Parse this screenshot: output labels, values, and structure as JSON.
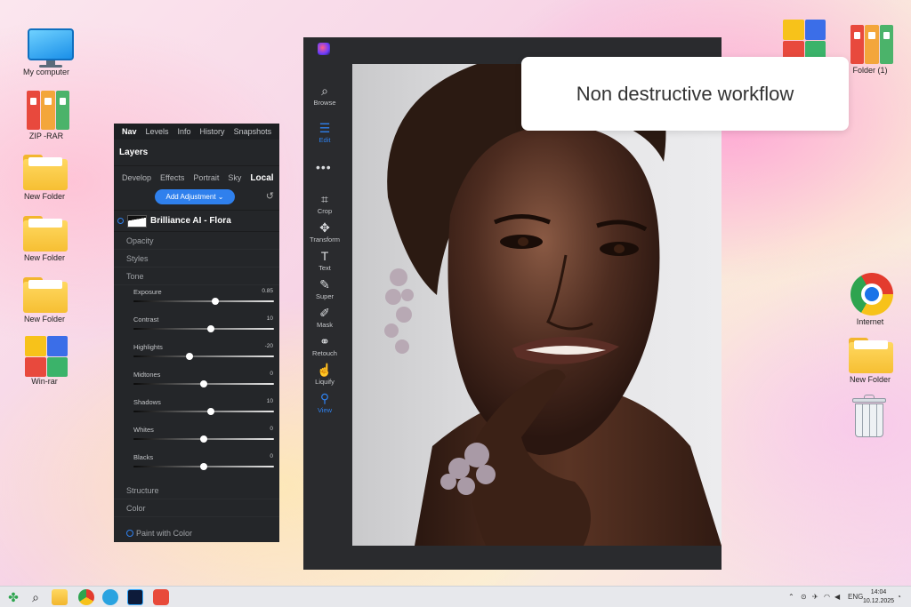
{
  "desktop": {
    "icons_left": [
      {
        "label": "My computer"
      },
      {
        "label": "ZIP -RAR"
      },
      {
        "label": "New Folder"
      },
      {
        "label": "New Folder"
      },
      {
        "label": "New Folder"
      },
      {
        "label": "Win-rar"
      }
    ],
    "icons_right": [
      {
        "label": ""
      },
      {
        "label": "Folder (1)"
      },
      {
        "label": "Internet"
      },
      {
        "label": "New Folder"
      },
      {
        "label": ""
      }
    ]
  },
  "panel": {
    "nav_tabs": [
      "Nav",
      "Levels",
      "Info",
      "History",
      "Snapshots"
    ],
    "title": "Layers",
    "tool_tabs": [
      "Develop",
      "Effects",
      "Portrait",
      "Sky",
      "Local"
    ],
    "add_adjustment": "Add Adjustment",
    "layer_name": "Brilliance AI - Flora",
    "sections_top": [
      "Opacity",
      "Styles",
      "Tone"
    ],
    "sliders": [
      {
        "name": "Exposure",
        "value": "0.85",
        "pos": 0.58
      },
      {
        "name": "Contrast",
        "value": "10",
        "pos": 0.55
      },
      {
        "name": "Highlights",
        "value": "-20",
        "pos": 0.4
      },
      {
        "name": "Midtones",
        "value": "0",
        "pos": 0.5
      },
      {
        "name": "Shadows",
        "value": "10",
        "pos": 0.55
      },
      {
        "name": "Whites",
        "value": "0",
        "pos": 0.5
      },
      {
        "name": "Blacks",
        "value": "0",
        "pos": 0.5
      }
    ],
    "sections_bottom": [
      "Structure",
      "Color"
    ],
    "paint_with_color": "Paint with Color"
  },
  "editor": {
    "tools": [
      {
        "icon": "browse-icon",
        "glyph": "⌕",
        "label": "Browse",
        "active": false
      },
      {
        "icon": "edit-icon",
        "glyph": "☰",
        "label": "Edit",
        "active": true
      },
      {
        "icon": "crop-icon",
        "glyph": "⌗",
        "label": "Crop",
        "active": false
      },
      {
        "icon": "transform-icon",
        "glyph": "✥",
        "label": "Transform",
        "active": false
      },
      {
        "icon": "text-icon",
        "glyph": "T",
        "label": "Text",
        "active": false
      },
      {
        "icon": "super-icon",
        "glyph": "✎",
        "label": "Super",
        "active": false
      },
      {
        "icon": "mask-icon",
        "glyph": "✐",
        "label": "Mask",
        "active": false
      },
      {
        "icon": "retouch-icon",
        "glyph": "⚭",
        "label": "Retouch",
        "active": false
      },
      {
        "icon": "liquify-icon",
        "glyph": "☝",
        "label": "Liquify",
        "active": false
      },
      {
        "icon": "view-icon",
        "glyph": "⚲",
        "label": "View",
        "active": true
      }
    ],
    "more_glyph": "•••"
  },
  "callout": {
    "text": "Non destructive workflow"
  },
  "taskbar": {
    "language": "ENG",
    "time": "14:04",
    "date": "10.12.2025"
  },
  "colors": {
    "accent": "#2f80ed",
    "panel_bg": "#242629",
    "editor_bg": "#2a2b2e"
  }
}
